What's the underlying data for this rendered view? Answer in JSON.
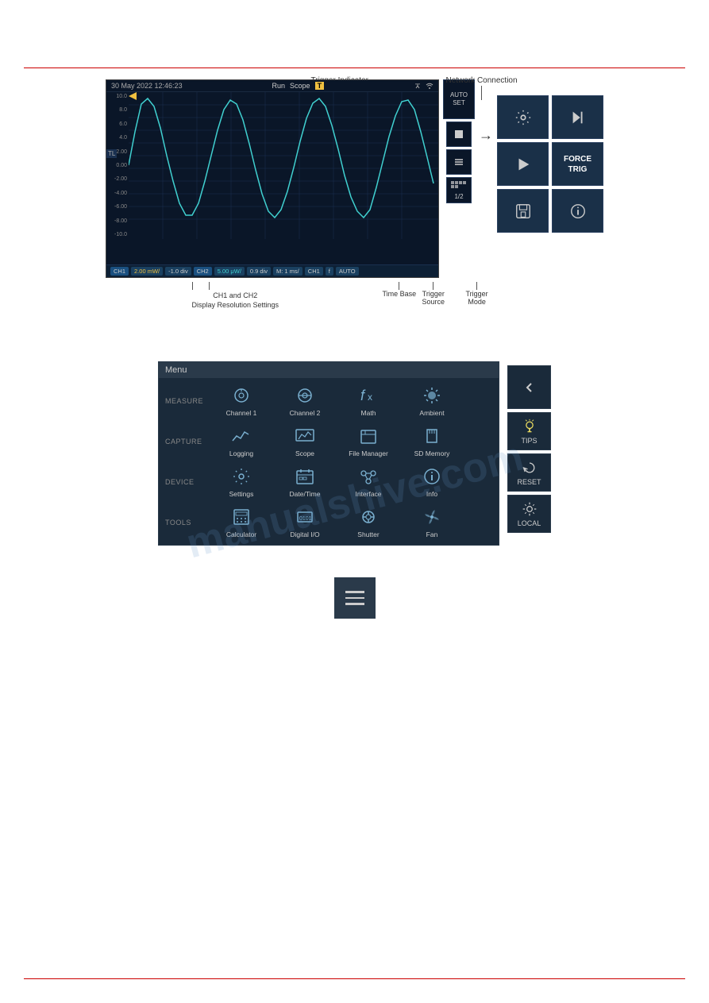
{
  "page": {
    "top_annotations": {
      "trigger_indicator": {
        "label": "Trigger\nIndicator",
        "line_visible": true
      },
      "network_connection": {
        "label": "Network\nConnection",
        "line_visible": true
      }
    },
    "scope": {
      "header": {
        "date_time": "30 May 2022 12:46:23",
        "run_label": "Run",
        "scope_label": "Scope",
        "trigger_badge": "T"
      },
      "y_labels": [
        "10.0 mW",
        "8.0 mW",
        "6.0 mW",
        "4.0 mW",
        "2.00 mW",
        "0.00 mW",
        "-2.00 mW",
        "-4.00 mW",
        "-6.00 mW",
        "-8.00 mW",
        "-10.0 mW"
      ],
      "tl_label": "TL",
      "bottom_tags": [
        {
          "label": "CH1",
          "style": "ch1"
        },
        {
          "label": "2.00 mW/",
          "style": "yellow"
        },
        {
          "label": "-1.0 div",
          "style": "normal"
        },
        {
          "label": "CH2",
          "style": "ch2"
        },
        {
          "label": "5.00 μW/",
          "style": "cyan"
        },
        {
          "label": "0.9 div",
          "style": "normal"
        },
        {
          "label": "M: 1 ms/",
          "style": "normal"
        },
        {
          "label": "CH1",
          "style": "normal"
        },
        {
          "label": "f",
          "style": "normal"
        },
        {
          "label": "AUTO",
          "style": "normal"
        }
      ],
      "auto_set_label": "AUTO\nSET",
      "page_indicator": "1/2",
      "side_buttons": [
        {
          "icon": "gear",
          "label": ""
        },
        {
          "icon": "skip-forward",
          "label": ""
        },
        {
          "icon": "play",
          "label": ""
        },
        {
          "icon": "force-trig",
          "label": "FORCE\nTRIG"
        },
        {
          "icon": "save",
          "label": ""
        },
        {
          "icon": "info",
          "label": ""
        }
      ]
    },
    "bottom_labels": {
      "ch1_ch2": "CH1 and CH2\nDisplay Resolution Settings",
      "time_base": "Time Base",
      "trigger_source": "Trigger\nSource",
      "trigger_mode": "Trigger\nMode"
    },
    "menu": {
      "title": "Menu",
      "sections": [
        {
          "label": "MEASURE",
          "items": [
            {
              "icon": "channel1",
              "label": "Channel 1"
            },
            {
              "icon": "channel2",
              "label": "Channel 2"
            },
            {
              "icon": "math",
              "label": "Math"
            },
            {
              "icon": "ambient",
              "label": "Ambient"
            }
          ]
        },
        {
          "label": "CAPTURE",
          "items": [
            {
              "icon": "logging",
              "label": "Logging"
            },
            {
              "icon": "scope",
              "label": "Scope"
            },
            {
              "icon": "file-manager",
              "label": "File Manager"
            },
            {
              "icon": "sd-memory",
              "label": "SD Memory"
            }
          ]
        },
        {
          "label": "DEVICE",
          "items": [
            {
              "icon": "settings",
              "label": "Settings"
            },
            {
              "icon": "datetime",
              "label": "Date/Time"
            },
            {
              "icon": "interface",
              "label": "Interface"
            },
            {
              "icon": "info",
              "label": "Info"
            }
          ]
        },
        {
          "label": "TOOLS",
          "items": [
            {
              "icon": "calculator",
              "label": "Calculator"
            },
            {
              "icon": "digital-io",
              "label": "Digital I/O"
            },
            {
              "icon": "shutter",
              "label": "Shutter"
            },
            {
              "icon": "fan",
              "label": "Fan"
            }
          ]
        }
      ],
      "right_panel": [
        {
          "icon": "back",
          "label": ""
        },
        {
          "icon": "tips",
          "label": "TIPS"
        },
        {
          "icon": "reset",
          "label": "RESET"
        },
        {
          "icon": "local",
          "label": "LOCAL"
        }
      ]
    },
    "hamburger_button": {
      "aria_label": "Menu button"
    }
  }
}
